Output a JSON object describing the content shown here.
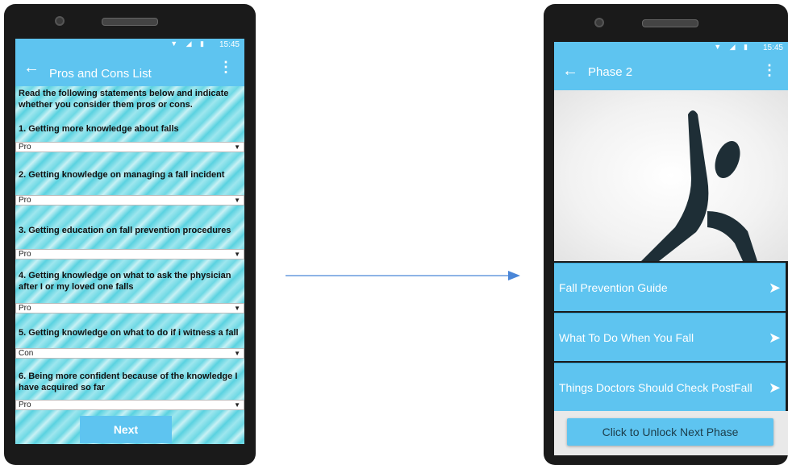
{
  "left_phone": {
    "status_time": "15:45",
    "status_icons": "▼ ◢ ▮",
    "title": "Pros and Cons List",
    "intro": "Read the following statements below and indicate whether you consider them pros or cons.",
    "items": [
      {
        "text": "1. Getting more knowledge about falls",
        "value": "Pro"
      },
      {
        "text": "2. Getting knowledge on managing a fall incident",
        "value": "Pro"
      },
      {
        "text": "3. Getting education on fall prevention procedures",
        "value": "Pro"
      },
      {
        "text": "4. Getting knowledge on what to ask the physician after I or my loved one falls",
        "value": "Pro"
      },
      {
        "text": "5. Getting knowledge on what to do if i witness a fall",
        "value": "Con"
      },
      {
        "text": "6. Being more confident because of the knowledge I have acquired so far",
        "value": "Pro"
      }
    ],
    "next_label": "Next"
  },
  "right_phone": {
    "status_time": "15:45",
    "status_icons": "▼ ◢ ▮",
    "title": "Phase 2",
    "menu": [
      {
        "label": "Fall Prevention Guide"
      },
      {
        "label": "What To Do When You Fall"
      },
      {
        "label": "Things Doctors Should Check PostFall"
      }
    ],
    "unlock_label": "Click to Unlock Next Phase"
  },
  "icons": {
    "back": "back-arrow-icon",
    "menu": "kebab-menu-icon",
    "send": "send-icon"
  },
  "colors": {
    "accent": "#5ec4f0",
    "arrow": "#4a86d8"
  }
}
